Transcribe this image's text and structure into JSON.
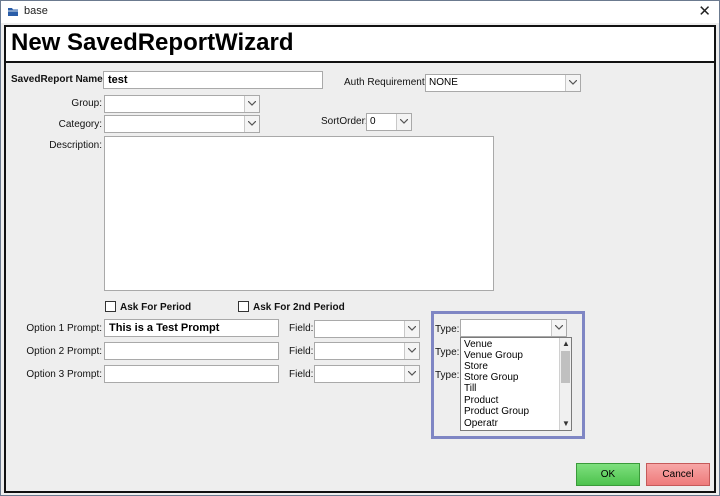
{
  "window": {
    "title": "base",
    "close_glyph": "✕"
  },
  "header": {
    "title": "New SavedReportWizard"
  },
  "form": {
    "saved_report_name": {
      "label": "SavedReport Name:",
      "value": "test"
    },
    "auth_requirement": {
      "label": "Auth Requirement:",
      "value": "NONE"
    },
    "group": {
      "label": "Group:",
      "value": ""
    },
    "category": {
      "label": "Category:",
      "value": ""
    },
    "sort_order": {
      "label": "SortOrder:",
      "value": "0"
    },
    "description": {
      "label": "Description:",
      "value": ""
    },
    "ask_for_period": {
      "label": "Ask For Period",
      "checked": false
    },
    "ask_for_2nd_period": {
      "label": "Ask For 2nd Period",
      "checked": false
    },
    "options": [
      {
        "label": "Option 1 Prompt:",
        "value": "This is a Test Prompt",
        "field_label": "Field:",
        "field_value": "",
        "type_label": "Type:",
        "type_value": ""
      },
      {
        "label": "Option 2 Prompt:",
        "value": "",
        "field_label": "Field:",
        "field_value": "",
        "type_label": "Type:"
      },
      {
        "label": "Option 3 Prompt:",
        "value": "",
        "field_label": "Field:",
        "field_value": "",
        "type_label": "Type:"
      }
    ]
  },
  "type_dropdown": {
    "options": [
      "Venue",
      "Venue Group",
      "Store",
      "Store Group",
      "Till",
      "Product",
      "Product Group",
      "Operatr"
    ]
  },
  "buttons": {
    "ok": "OK",
    "cancel": "Cancel"
  },
  "colors": {
    "ok_green": "#5ccf5c",
    "cancel_red": "#f08a8a",
    "highlight_border": "#7f86c4"
  }
}
